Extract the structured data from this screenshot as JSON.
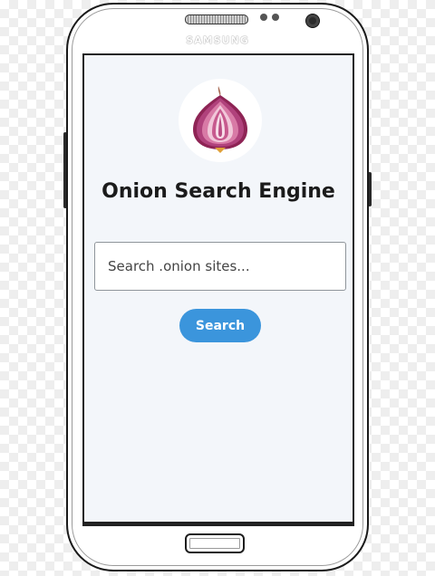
{
  "device": {
    "brand": "SAMSUNG"
  },
  "app": {
    "logo_icon": "onion-icon",
    "title": "Onion Search Engine"
  },
  "search": {
    "placeholder": "Search .onion sites...",
    "value": "",
    "button_label": "Search"
  },
  "colors": {
    "screen_background": "#f3f6fa",
    "button_accent": "#3b95dc",
    "onion_purple": "#b03e78",
    "onion_light": "#f1c7d9"
  }
}
